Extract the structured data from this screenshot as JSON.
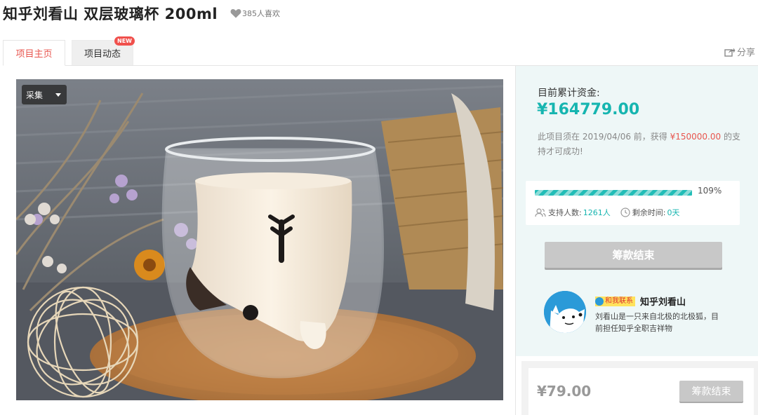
{
  "title": "知乎刘看山 双层玻璃杯 200ml",
  "likes": "385人喜欢",
  "tabs": [
    {
      "label": "项目主页"
    },
    {
      "label": "项目动态",
      "badge": "NEW"
    }
  ],
  "share_label": "分享",
  "image": {
    "collect_label": "采集"
  },
  "funding": {
    "label": "目前累计资金:",
    "amount": "¥164779.00",
    "note_prefix": "此项目须在 2019/04/06 前，获得 ",
    "note_goal": "¥150000.00",
    "note_suffix": " 的支持才可成功!",
    "progress_fraction": 1.0,
    "percent": "109%",
    "supporters_label": "支持人数:",
    "supporters_value": "1261人",
    "remaining_label": "剩余时间:",
    "remaining_value": "0天",
    "status_button": "筹款结束"
  },
  "owner": {
    "contact_label": "和我联系",
    "name": "知乎刘看山",
    "description": "刘看山是一只来自北极的北极狐，目前担任知乎全职吉祥物"
  },
  "tier": {
    "price": "¥79.00",
    "button": "筹款结束"
  },
  "colors": {
    "accent": "#16b5b0",
    "highlight": "#e8554e",
    "disabled": "#c8c8c8"
  }
}
